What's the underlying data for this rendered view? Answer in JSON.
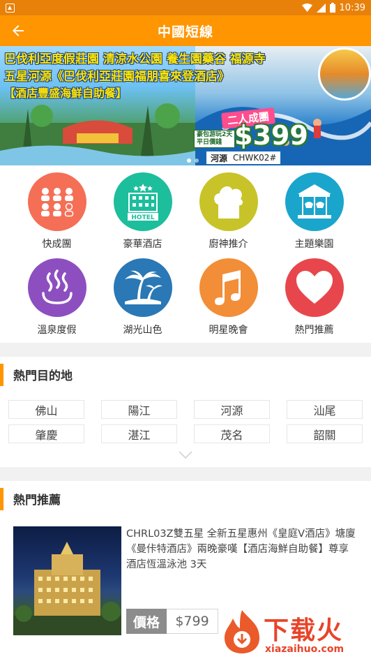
{
  "status_bar": {
    "time": "10:39"
  },
  "app_bar": {
    "title": "中國短線"
  },
  "banner": {
    "line1": "巴伐利亞度假莊園 清涼水公園 養生園藥谷 福源寺",
    "line2": "五星河源《巴伐利亞莊園福朋喜來登酒店》",
    "line3": "【酒店豐盛海鮮自助餐】",
    "promo_tag": "二人成團",
    "promo_small_1": "豪包游玩2天",
    "promo_small_2": "平日價錢",
    "price": "$399",
    "place": "河源",
    "code": "CHWK02#",
    "dot_count": 2,
    "active_dot": 0
  },
  "categories": [
    {
      "label": "快成團",
      "icon": "group-people-icon",
      "color": "#f46f56"
    },
    {
      "label": "豪華酒店",
      "icon": "hotel-icon",
      "color": "#1cbe9c"
    },
    {
      "label": "廚神推介",
      "icon": "chef-hat-icon",
      "color": "#c8c329"
    },
    {
      "label": "主題樂園",
      "icon": "carousel-icon",
      "color": "#1aa5cc"
    },
    {
      "label": "溫泉度假",
      "icon": "hot-spring-icon",
      "color": "#8d4fc0"
    },
    {
      "label": "湖光山色",
      "icon": "palm-island-icon",
      "color": "#2a78b5"
    },
    {
      "label": "明星晚會",
      "icon": "music-note-icon",
      "color": "#f28e37"
    },
    {
      "label": "熱門推薦",
      "icon": "heart-icon",
      "color": "#e8464d"
    }
  ],
  "hot_destinations": {
    "title": "熱門目的地",
    "items": [
      "佛山",
      "陽江",
      "河源",
      "汕尾",
      "肇慶",
      "湛江",
      "茂名",
      "韶關"
    ]
  },
  "hot_recommend": {
    "title": "熱門推薦",
    "items": [
      {
        "title": "CHRL03Z雙五星 全新五星惠州《皇庭V酒店》塘廈《曼佧特酒店》兩晚豪嘆【酒店海鮮自助餐】尊享酒店恆溫泳池 3天",
        "price_label": "價格",
        "price": "$799"
      }
    ]
  },
  "watermark": {
    "text": "下载火",
    "url": "xiazaihuo.com"
  },
  "colors": {
    "accent": "#ff9500",
    "status_bar": "#e8810a"
  }
}
